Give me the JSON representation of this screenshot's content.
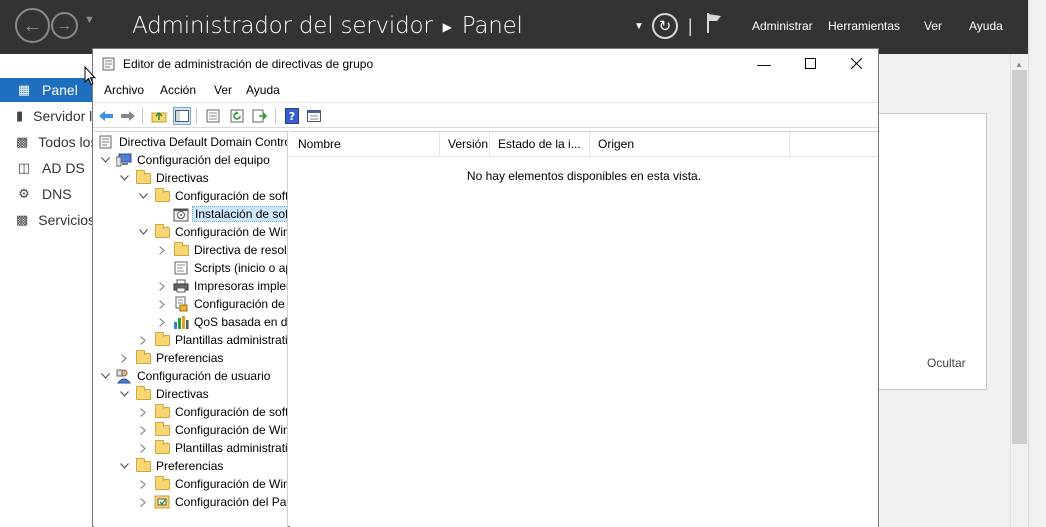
{
  "server_manager": {
    "title": "Administrador del servidor",
    "section": "Panel",
    "menu": {
      "manage": "Administrar",
      "tools": "Herramientas",
      "view": "Ver",
      "help": "Ayuda"
    },
    "sidebar": [
      {
        "label": "Panel",
        "icon": "dashboard-icon",
        "active": true
      },
      {
        "label": "Servidor local",
        "icon": "server-icon",
        "active": false
      },
      {
        "label": "Todos los servidores",
        "icon": "servers-icon",
        "active": false
      },
      {
        "label": "AD DS",
        "icon": "ad-ds-icon",
        "active": false
      },
      {
        "label": "DNS",
        "icon": "dns-icon",
        "active": false
      },
      {
        "label": "Servicios de archivos",
        "icon": "file-services-icon",
        "active": false
      }
    ],
    "hide_label": "Ocultar"
  },
  "gpo_editor": {
    "title": "Editor de administración de directivas de grupo",
    "menus": [
      "Archivo",
      "Acción",
      "Ver",
      "Ayuda"
    ],
    "tree": [
      {
        "label": "Directiva Default Domain Controllers",
        "level": 0,
        "expander": "",
        "icon": "policy-icon"
      },
      {
        "label": "Configuración del equipo",
        "level": 0,
        "expander": "open",
        "icon": "computer-icon"
      },
      {
        "label": "Directivas",
        "level": 1,
        "expander": "open",
        "icon": "folder-icon"
      },
      {
        "label": "Configuración de software",
        "level": 2,
        "expander": "open",
        "icon": "folder-icon"
      },
      {
        "label": "Instalación de software",
        "level": 3,
        "expander": "",
        "icon": "software-install-icon",
        "selected": true
      },
      {
        "label": "Configuración de Windows",
        "level": 2,
        "expander": "open",
        "icon": "folder-icon"
      },
      {
        "label": "Directiva de resolución de nombres",
        "level": 3,
        "expander": "closed",
        "icon": "folder-icon"
      },
      {
        "label": "Scripts (inicio o apagado)",
        "level": 3,
        "expander": "",
        "icon": "script-icon"
      },
      {
        "label": "Impresoras implementadas",
        "level": 3,
        "expander": "closed",
        "icon": "printer-icon"
      },
      {
        "label": "Configuración de seguridad",
        "level": 3,
        "expander": "closed",
        "icon": "security-icon"
      },
      {
        "label": "QoS basada en directivas",
        "level": 3,
        "expander": "closed",
        "icon": "qos-chart-icon"
      },
      {
        "label": "Plantillas administrativas",
        "level": 2,
        "expander": "closed",
        "icon": "folder-icon"
      },
      {
        "label": "Preferencias",
        "level": 1,
        "expander": "closed",
        "icon": "folder-icon"
      },
      {
        "label": "Configuración de usuario",
        "level": 0,
        "expander": "open",
        "icon": "user-icon"
      },
      {
        "label": "Directivas",
        "level": 1,
        "expander": "open",
        "icon": "folder-icon"
      },
      {
        "label": "Configuración de software",
        "level": 2,
        "expander": "closed",
        "icon": "folder-icon"
      },
      {
        "label": "Configuración de Windows",
        "level": 2,
        "expander": "closed",
        "icon": "folder-icon"
      },
      {
        "label": "Plantillas administrativas",
        "level": 2,
        "expander": "closed",
        "icon": "folder-icon"
      },
      {
        "label": "Preferencias",
        "level": 1,
        "expander": "open",
        "icon": "folder-icon"
      },
      {
        "label": "Configuración de Windows",
        "level": 2,
        "expander": "closed",
        "icon": "folder-icon"
      },
      {
        "label": "Configuración del Panel de control",
        "level": 2,
        "expander": "closed",
        "icon": "control-panel-icon"
      }
    ],
    "columns": [
      "Nombre",
      "Versión",
      "Estado de la i...",
      "Origen"
    ],
    "empty_message": "No hay elementos disponibles en esta vista."
  }
}
